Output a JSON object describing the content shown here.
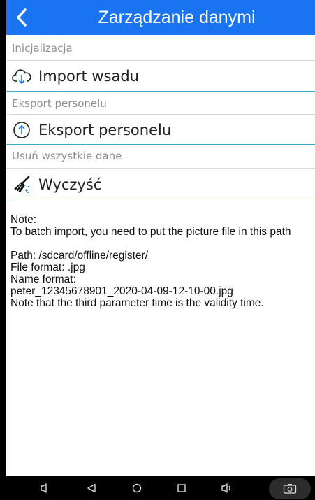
{
  "header": {
    "title": "Zarządzanie danymi",
    "back_icon": "chevron-left-icon"
  },
  "sections": [
    {
      "label": "Inicjalizacja",
      "item_label": "Import wsadu",
      "icon": "cloud-download-icon"
    },
    {
      "label": "Eksport personelu",
      "item_label": "Eksport personelu",
      "icon": "circle-arrow-up-icon"
    },
    {
      "label": "Usuń wszystkie dane",
      "item_label": "Wyczyść",
      "icon": "broom-icon"
    }
  ],
  "notes": {
    "line1": "Note:",
    "line2": "To batch import, you need to put the picture file in this path",
    "line3": "Path: /sdcard/offline/register/",
    "line4": "File format: .jpg",
    "line5": "Name format:",
    "line6": "peter_12345678901_2020-04-09-12-10-00.jpg",
    "line7": "Note that the third parameter time is the validity time."
  },
  "navbar": {
    "buttons": [
      "volume-down-icon",
      "back-triangle-icon",
      "home-circle-icon",
      "recents-square-icon",
      "volume-up-icon",
      "screenshot-icon"
    ]
  },
  "colors": {
    "accent": "#1a73f0",
    "divider": "#4aa8d8",
    "label_gray": "#8e8e8e"
  }
}
